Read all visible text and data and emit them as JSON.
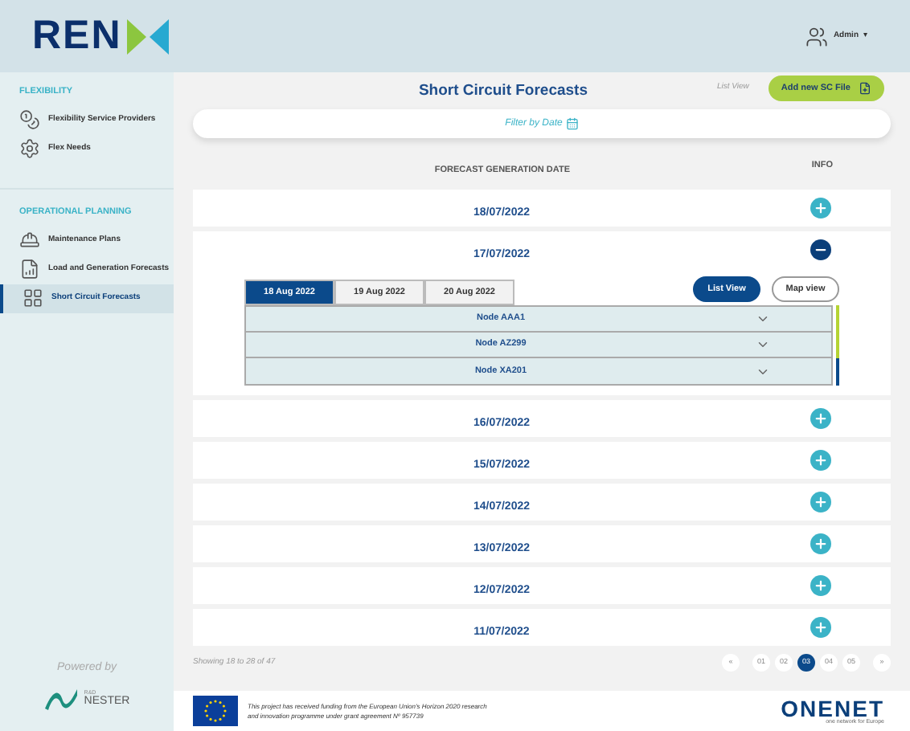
{
  "header": {
    "logo": "REN",
    "user": "Admin",
    "user_caret": "▾"
  },
  "sidebar": {
    "sections": [
      {
        "title": "FLEXIBILITY",
        "items": [
          {
            "label": "Flexibility Service Providers",
            "selected": false
          },
          {
            "label": "Flex Needs",
            "selected": false
          }
        ]
      },
      {
        "title": "OPERATIONAL PLANNING",
        "items": [
          {
            "label": "Maintenance Plans",
            "selected": false
          },
          {
            "label": "Load and Generation Forecasts",
            "selected": false
          },
          {
            "label": "Short Circuit Forecasts",
            "selected": true
          }
        ]
      }
    ],
    "powered_by": "Powered by",
    "partner_small": "R&D",
    "partner": "NESTER"
  },
  "page": {
    "title": "Short Circuit Forecasts",
    "view_label": "List View",
    "add_button": "Add new SC File",
    "filter": "Filter by Date"
  },
  "table": {
    "columns": [
      "FORECAST GENERATION DATE",
      "INFO"
    ],
    "rows": [
      {
        "date": "18/07/2022",
        "expanded": false
      },
      {
        "date": "17/07/2022",
        "expanded": true,
        "tabs": [
          {
            "label": "18 Aug 2022",
            "selected": true
          },
          {
            "label": "19 Aug 2022",
            "selected": false
          },
          {
            "label": "20 Aug 2022",
            "selected": false
          }
        ],
        "views": [
          {
            "label": "List View",
            "selected": true
          },
          {
            "label": "Map view",
            "selected": false
          }
        ],
        "nodes": [
          {
            "name": "Node AAA1"
          },
          {
            "name": "Node AZ299"
          },
          {
            "name": "Node XA201"
          }
        ]
      },
      {
        "date": "16/07/2022",
        "expanded": false
      },
      {
        "date": "15/07/2022",
        "expanded": false
      },
      {
        "date": "14/07/2022",
        "expanded": false
      },
      {
        "date": "13/07/2022",
        "expanded": false
      },
      {
        "date": "12/07/2022",
        "expanded": false
      },
      {
        "date": "11/07/2022",
        "expanded": false
      }
    ]
  },
  "showing": "Showing 18 to 28 of 47",
  "pagination": [
    {
      "label": "«",
      "selected": false
    },
    {
      "label": "01",
      "selected": false
    },
    {
      "label": "02",
      "selected": false
    },
    {
      "label": "03",
      "selected": true
    },
    {
      "label": "04",
      "selected": false
    },
    {
      "label": "05",
      "selected": false
    },
    {
      "label": "»",
      "selected": false
    }
  ],
  "footer": {
    "funding": "This project has received funding from the European Union's Horizon 2020 research and innovation programme under grant agreement Nº 957739",
    "brand": "ONENET",
    "brand_tagline": "one network for Europe"
  }
}
